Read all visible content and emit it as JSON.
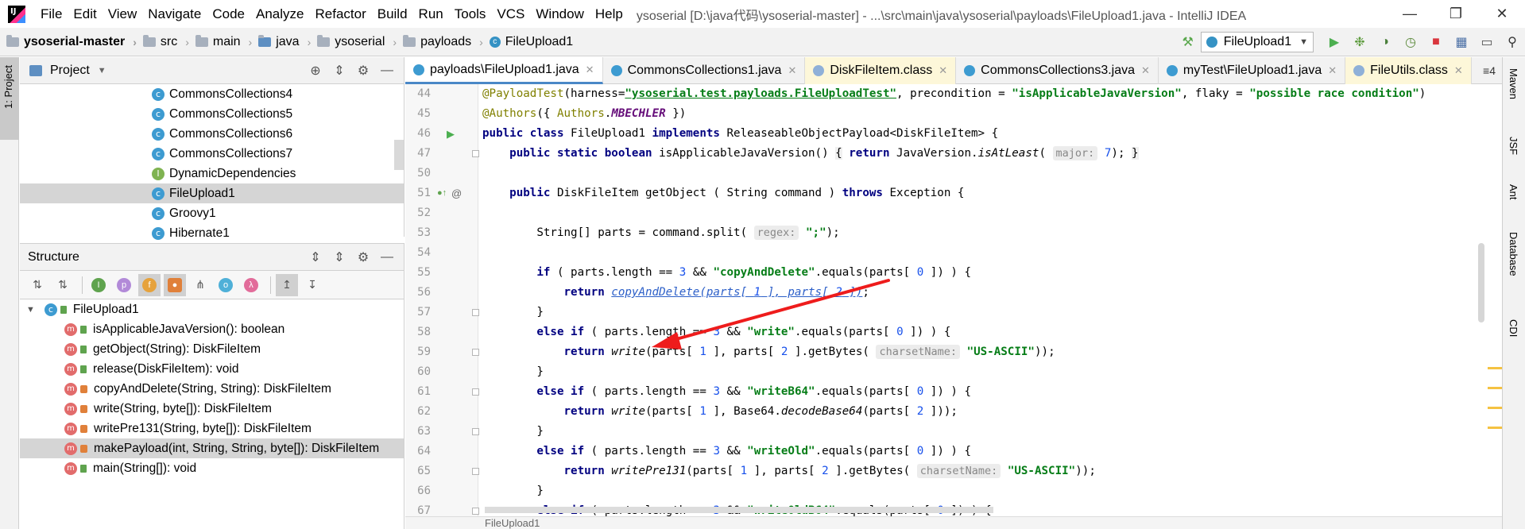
{
  "titlebar": {
    "menu": [
      "File",
      "Edit",
      "View",
      "Navigate",
      "Code",
      "Analyze",
      "Refactor",
      "Build",
      "Run",
      "Tools",
      "VCS",
      "Window",
      "Help"
    ],
    "title": "ysoserial [D:\\java代码\\ysoserial-master] - ...\\src\\main\\java\\ysoserial\\payloads\\FileUpload1.java - IntelliJ IDEA"
  },
  "navbar": {
    "crumbs": [
      "ysoserial-master",
      "src",
      "main",
      "java",
      "ysoserial",
      "payloads",
      "FileUpload1"
    ],
    "run_config": "FileUpload1"
  },
  "left_strip": {
    "project_tab": "1: Project"
  },
  "project_panel": {
    "title": "Project",
    "items": [
      {
        "label": "CommonsCollections4",
        "kind": "class"
      },
      {
        "label": "CommonsCollections5",
        "kind": "class"
      },
      {
        "label": "CommonsCollections6",
        "kind": "class"
      },
      {
        "label": "CommonsCollections7",
        "kind": "class"
      },
      {
        "label": "DynamicDependencies",
        "kind": "interface"
      },
      {
        "label": "FileUpload1",
        "kind": "class"
      },
      {
        "label": "Groovy1",
        "kind": "class"
      },
      {
        "label": "Hibernate1",
        "kind": "class"
      }
    ]
  },
  "structure_panel": {
    "title": "Structure",
    "root": "FileUpload1",
    "members": [
      {
        "label": "isApplicableJavaVersion(): boolean",
        "vis": "public"
      },
      {
        "label": "getObject(String): DiskFileItem",
        "vis": "public"
      },
      {
        "label": "release(DiskFileItem): void",
        "vis": "public"
      },
      {
        "label": "copyAndDelete(String, String): DiskFileItem",
        "vis": "private"
      },
      {
        "label": "write(String, byte[]): DiskFileItem",
        "vis": "private"
      },
      {
        "label": "writePre131(String, byte[]): DiskFileItem",
        "vis": "private"
      },
      {
        "label": "makePayload(int, String, String, byte[]): DiskFileItem",
        "vis": "private"
      },
      {
        "label": "main(String[]): void",
        "vis": "public"
      }
    ]
  },
  "editor": {
    "tabs": [
      {
        "label": "payloads\\FileUpload1.java",
        "active": true,
        "binary": false
      },
      {
        "label": "CommonsCollections1.java",
        "active": false,
        "binary": false
      },
      {
        "label": "DiskFileItem.class",
        "active": false,
        "binary": true
      },
      {
        "label": "CommonsCollections3.java",
        "active": false,
        "binary": false
      },
      {
        "label": "myTest\\FileUpload1.java",
        "active": false,
        "binary": false
      },
      {
        "label": "FileUtils.class",
        "active": false,
        "binary": true
      }
    ],
    "tabs_more": "≡4",
    "line_numbers": [
      "44",
      "45",
      "46",
      "47",
      "50",
      "51",
      "52",
      "53",
      "54",
      "55",
      "56",
      "57",
      "58",
      "59",
      "60",
      "61",
      "62",
      "63",
      "64",
      "65",
      "66",
      "67"
    ],
    "bottom_breadcrumb": "FileUpload1"
  },
  "right_strip": [
    "Maven",
    "JSF",
    "Ant",
    "Database",
    "CDI"
  ],
  "colors": {
    "keyword": "#000080",
    "string": "#067d17",
    "annotation": "#808000",
    "number": "#1750eb",
    "accent": "#4a88c7",
    "arrow": "#ee1c1c"
  }
}
